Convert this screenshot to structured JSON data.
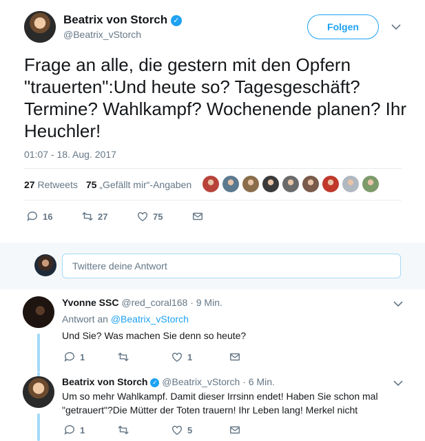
{
  "tweet": {
    "author": {
      "name": "Beatrix von Storch",
      "handle": "@Beatrix_vStorch"
    },
    "follow_label": "Folgen",
    "text": "Frage an alle, die gestern mit den Opfern \"trauerten\":Und heute so? Tagesgeschäft? Termine? Wahlkampf? Wochenende planen? Ihr Heuchler!",
    "timestamp": "01:07 - 18. Aug. 2017",
    "retweets_count": "27",
    "retweets_label": "Retweets",
    "likes_count": "75",
    "likes_label": "„Gefällt mir“-Angaben",
    "likers": [
      "#b8433a",
      "#5c7a8f",
      "#8a6d4a",
      "#3a3a3a",
      "#6a6a6a",
      "#7a5a4a",
      "#c0392b",
      "#b0b8c0",
      "#7d9a6a"
    ],
    "actions": {
      "replies": "16",
      "retweets": "27",
      "likes": "75"
    }
  },
  "reply_box": {
    "placeholder": "Twittere deine Antwort"
  },
  "replies": [
    {
      "name": "Yvonne SSC",
      "handle": "@red_coral168",
      "time": "· 9 Min.",
      "reply_to_prefix": "Antwort an ",
      "reply_to_handle": "@Beatrix_vStorch",
      "text": "Und Sie? Was machen Sie denn so heute?",
      "actions": {
        "replies": "1",
        "retweets": "",
        "likes": "1"
      }
    },
    {
      "name": "Beatrix von Storch",
      "handle": "@Beatrix_vStorch",
      "time": "· 6 Min.",
      "text": "Um so mehr Wahlkampf. Damit dieser Irrsinn endet! Haben Sie schon mal \"getrauert\"?Die Mütter der Toten trauern! Ihr Leben lang! Merkel nicht",
      "actions": {
        "replies": "1",
        "retweets": "",
        "likes": "5"
      }
    }
  ],
  "colors": {
    "accent": "#1da1f2",
    "muted": "#657786",
    "thread": "#a4d9f9"
  }
}
